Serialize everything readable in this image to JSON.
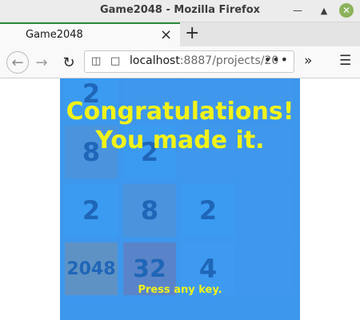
{
  "window": {
    "title": "Game2048 - Mozilla Firefox"
  },
  "tab": {
    "label": "Game2048"
  },
  "address": {
    "host": "localhost",
    "rest": ":8887/projects/20"
  },
  "colors": {
    "board": "#3d97ec",
    "overlay_text": "#f1f21a",
    "tile_text": "#1f66b8"
  },
  "board": {
    "tiles": [
      {
        "value": "2"
      },
      {
        "value": ""
      },
      {
        "value": ""
      },
      {
        "value": ""
      },
      {
        "value": "8"
      },
      {
        "value": "2"
      },
      {
        "value": ""
      },
      {
        "value": ""
      },
      {
        "value": "2"
      },
      {
        "value": "8"
      },
      {
        "value": "2"
      },
      {
        "value": ""
      },
      {
        "value": "2048"
      },
      {
        "value": "32"
      },
      {
        "value": "4"
      },
      {
        "value": ""
      }
    ]
  },
  "overlay": {
    "line1": "Congratulations!",
    "line2": "You made it.",
    "prompt": "Press any key."
  }
}
